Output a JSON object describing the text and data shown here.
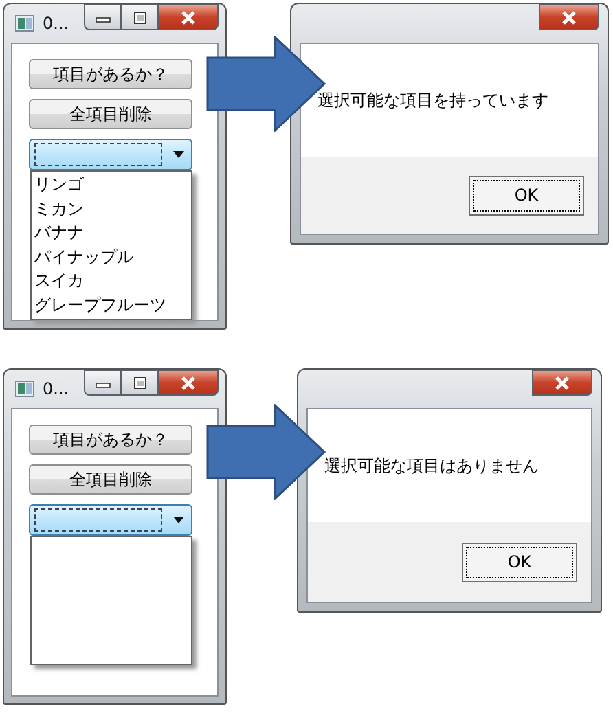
{
  "scenarios": [
    {
      "window": {
        "title": "0...",
        "buttons": [
          "項目があるか？",
          "全項目削除"
        ],
        "combo": {
          "expanded": true,
          "items": [
            "リンゴ",
            "ミカン",
            "バナナ",
            "パイナップル",
            "スイカ",
            "グレープフルーツ"
          ]
        }
      },
      "dialog": {
        "message": "選択可能な項目を持っています",
        "ok": "OK"
      }
    },
    {
      "window": {
        "title": "0...",
        "buttons": [
          "項目があるか？",
          "全項目削除"
        ],
        "combo": {
          "expanded": true
        }
      },
      "dialog": {
        "message": "選択可能な項目はありません",
        "ok": "OK"
      }
    }
  ]
}
